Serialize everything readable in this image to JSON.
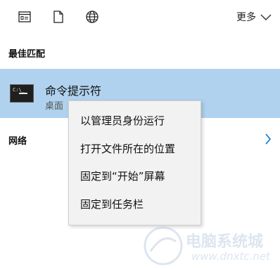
{
  "toolbar": {
    "icons": [
      "apps-icon",
      "documents-icon",
      "web-icon"
    ],
    "more_label": "更多"
  },
  "best_match": {
    "section_title": "最佳匹配",
    "app_name": "命令提示符",
    "app_subtitle": "桌面",
    "icon_text": "C:\\_"
  },
  "network": {
    "section_title": "网络"
  },
  "context_menu": {
    "items": [
      "以管理员身份运行",
      "打开文件所在的位置",
      "固定到“开始”屏幕",
      "固定到任务栏"
    ]
  },
  "watermark": {
    "text": "电脑系统城",
    "url": "www.dnxtc.net"
  },
  "colors": {
    "selection": "#b0d2ee",
    "menu_bg": "#f2f2f2",
    "accent": "#0078d7"
  }
}
